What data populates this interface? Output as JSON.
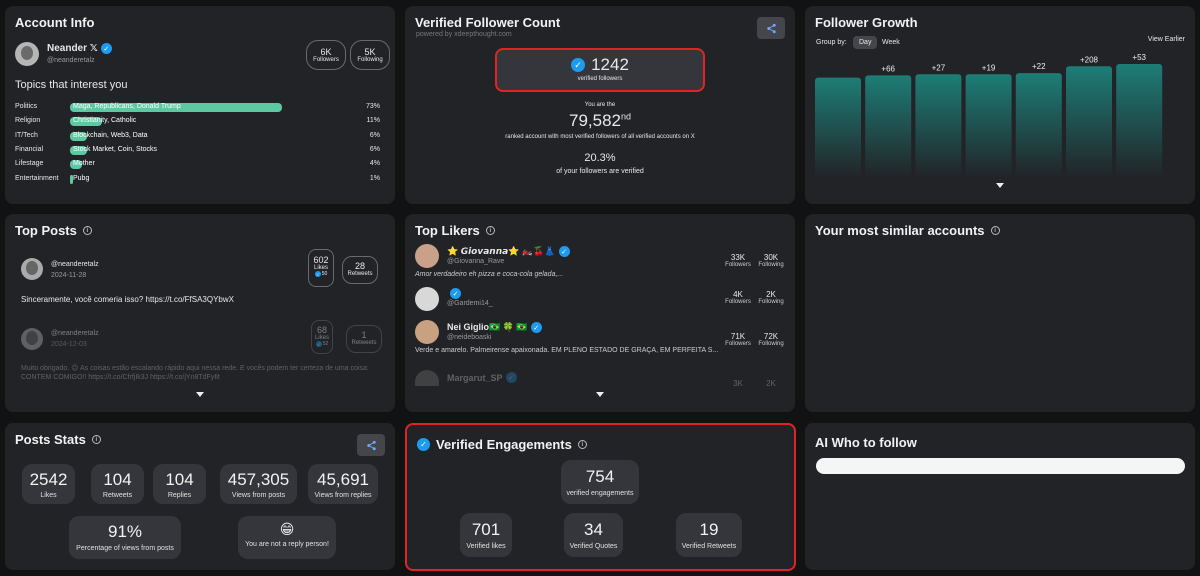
{
  "account_info": {
    "title": "Account Info",
    "name": "Neander 𝕏",
    "handle": "@neanderetalz",
    "followers_value": "6K",
    "followers_label": "Followers",
    "following_value": "5K",
    "following_label": "Following",
    "topics_heading": "Topics that interest you",
    "topics": [
      {
        "label": "Politics",
        "desc": "Maga, Republicans, Donald Trump",
        "pct": "73%",
        "fraction": 0.73
      },
      {
        "label": "Religion",
        "desc": "Christianity, Catholic",
        "pct": "11%",
        "fraction": 0.11
      },
      {
        "label": "IT/Tech",
        "desc": "Blockchain, Web3, Data",
        "pct": "6%",
        "fraction": 0.06
      },
      {
        "label": "Financial",
        "desc": "Stock Market, Coin, Stocks",
        "pct": "6%",
        "fraction": 0.06
      },
      {
        "label": "Lifestage",
        "desc": "Mother",
        "pct": "4%",
        "fraction": 0.04
      },
      {
        "label": "Entertainment",
        "desc": "Pubg",
        "pct": "1%",
        "fraction": 0.01
      }
    ]
  },
  "verified_count": {
    "title": "Verified Follower Count",
    "subtitle": "powered by xdeepthought.com",
    "count": "1242",
    "count_label": "verified followers",
    "you_are_the": "You are the",
    "rank": "79,582",
    "rank_suffix": "nd",
    "rank_desc": "ranked account with most verified followers of all verified accounts on X",
    "pct": "20.3%",
    "pct_desc": "of your followers are verified"
  },
  "follower_growth": {
    "title": "Follower Growth",
    "group_by_label": "Group by:",
    "options": [
      "Day",
      "Week"
    ],
    "selected": "Day",
    "view_earlier": "View Earlier",
    "bar_labels": [
      "",
      "+66",
      "+27",
      "+19",
      "+22",
      "+208",
      "+53"
    ],
    "bar_relative_heights": [
      0.88,
      0.9,
      0.91,
      0.91,
      0.92,
      0.98,
      1.0
    ]
  },
  "top_posts": {
    "title": "Top Posts",
    "posts": [
      {
        "handle": "@neanderetalz",
        "date": "2024-11-28",
        "likes_value": "602",
        "likes_label": "Likes",
        "verified_likes": "50",
        "retweets_value": "28",
        "retweets_label": "Retweets",
        "text": "Sinceramente, você comeria isso? https://t.co/FfSA3QYbwX"
      },
      {
        "handle": "@neanderetalz",
        "date": "2024-12-03",
        "likes_value": "68",
        "likes_label": "Likes",
        "verified_likes": "52",
        "retweets_value": "1",
        "retweets_label": "Retweets",
        "text": "Muito obrigado. 😉 As coisas estão escalando rápido aqui nessa rede. E vocês podem ter certeza de uma coisa: CONTEM COMIGO!! https://t.co/CfrfjIk3J https://t.co/jYn8TdFyIlt"
      }
    ]
  },
  "top_likers": {
    "title": "Top Likers",
    "likers": [
      {
        "name": "⭐ 𝙂𝙞𝙤𝙫𝙖𝙣𝙣𝙖⭐ 🏍️🍒👗",
        "handle": "@Giovanna_Rave",
        "bio": "Amor verdadeiro eh pizza e coca-cola gelada,...",
        "followers_value": "33K",
        "followers_label": "Followers",
        "following_value": "30K",
        "following_label": "Following"
      },
      {
        "name": "",
        "handle": "@Gardemi14_",
        "bio": "",
        "followers_value": "4K",
        "followers_label": "Followers",
        "following_value": "2K",
        "following_label": "Following"
      },
      {
        "name": "Nei Giglio🇧🇷 🍀 🇧🇷",
        "handle": "@neideboaski",
        "bio": "Verde e amarelo. Palmeirense apaixonada. EM PLENO ESTADO DE GRAÇA, EM PERFEITA S...",
        "followers_value": "71K",
        "followers_label": "Followers",
        "following_value": "72K",
        "following_label": "Following"
      },
      {
        "name": "Margarut_SP",
        "handle": "",
        "bio": "",
        "followers_value": "3K",
        "followers_label": "",
        "following_value": "2K",
        "following_label": ""
      }
    ]
  },
  "similar_accounts": {
    "title": "Your most similar accounts"
  },
  "posts_stats": {
    "title": "Posts Stats",
    "stats": [
      {
        "value": "2542",
        "label": "Likes"
      },
      {
        "value": "104",
        "label": "Retweets"
      },
      {
        "value": "104",
        "label": "Replies"
      },
      {
        "value": "457,305",
        "label": "Views from posts"
      },
      {
        "value": "45,691",
        "label": "Views from replies"
      }
    ],
    "views_pct_value": "91%",
    "views_pct_label": "Percentage of views from posts",
    "reply_emoji": "😁",
    "reply_label": "You are not a reply person!"
  },
  "verified_engagements": {
    "title": "Verified Engagements",
    "total_value": "754",
    "total_label": "verified engagements",
    "likes_value": "701",
    "likes_label": "Verified likes",
    "quotes_value": "34",
    "quotes_label": "Verified Quotes",
    "retweets_value": "19",
    "retweets_label": "Verified Retweets"
  },
  "ai_who_to_follow": {
    "title": "AI Who to follow"
  },
  "colors": {
    "accent_green": "#5cc9a3",
    "highlight_red": "#e02424",
    "verified_blue": "#1d9bf0",
    "bar_teal": "#1d7d76"
  }
}
